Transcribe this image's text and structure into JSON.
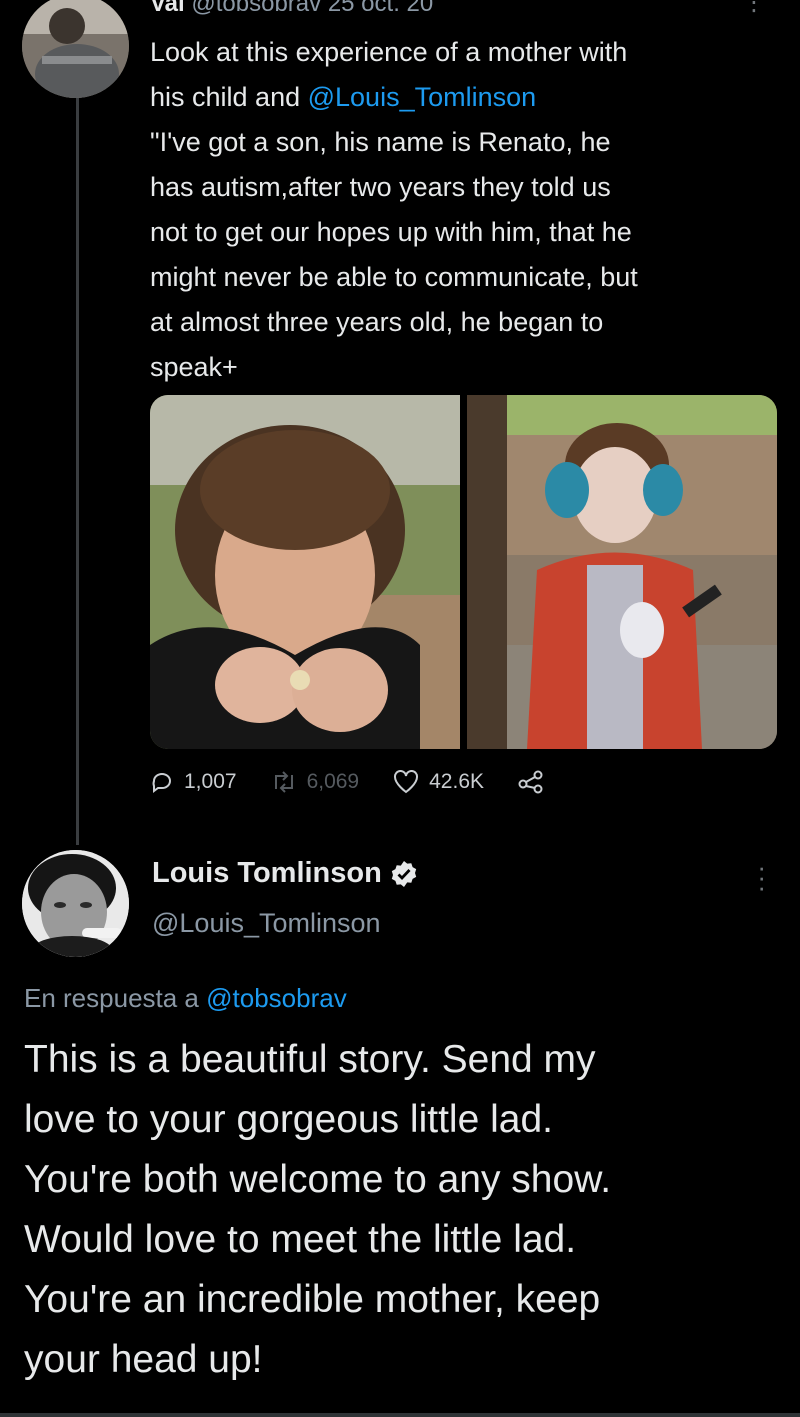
{
  "original_tweet": {
    "author_name": "Val",
    "handle": "@tobsobrav",
    "date": "25 oct. 20",
    "text_lines": [
      "Look at this experience of a mother with",
      "his child and ",
      "\"I've got a son, his name is Renato, he",
      "has autism,after two years they told us",
      "not to get our hopes up with him, that he",
      "might never be able to communicate, but",
      "at almost three years old, he began to",
      "speak+"
    ],
    "mention": "@Louis_Tomlinson",
    "replies": "1,007",
    "retweets": "6,069",
    "likes": "42.6K"
  },
  "reply_tweet": {
    "author_name": "Louis Tomlinson",
    "handle": "@Louis_Tomlinson",
    "reply_prefix": "En respuesta a ",
    "reply_mention": "@tobsobrav",
    "text_lines": [
      "This is a beautiful story. Send my",
      "love to your gorgeous little lad.",
      "You're both welcome to any show.",
      "Would love to meet the little lad.",
      "You're an incredible mother, keep",
      "your head up!"
    ]
  },
  "icons": [
    "reply-icon",
    "retweet-icon",
    "like-icon",
    "share-icon",
    "verified-badge-icon",
    "more-icon"
  ],
  "colors": {
    "background": "#000000",
    "text": "#e7e9ea",
    "muted": "#8b98a5",
    "accent": "#1d9bf0"
  }
}
